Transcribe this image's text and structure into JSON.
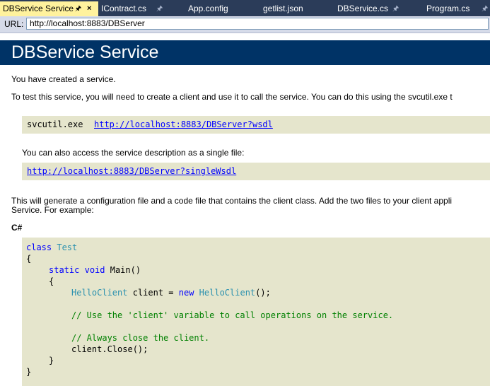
{
  "tabs": [
    {
      "label": "DBService Service",
      "active": true
    },
    {
      "label": "IContract.cs"
    },
    {
      "label": "App.config"
    },
    {
      "label": "getlist.json"
    },
    {
      "label": "DBService.cs"
    },
    {
      "label": "Program.cs"
    }
  ],
  "url_bar": {
    "label": "URL:",
    "value": "http://localhost:8883/DBServer"
  },
  "page": {
    "title": "DBService Service",
    "created_text": "You have created a service.",
    "test_text": "To test this service, you will need to create a client and use it to call the service. You can do this using the svcutil.exe t",
    "svcutil_cmd": "svcutil.exe",
    "wsdl_link": "http://localhost:8883/DBServer?wsdl",
    "single_file_text": "You can also access the service description as a single file:",
    "single_wsdl_link": "http://localhost:8883/DBServer?singleWsdl",
    "generate_text_1": "This will generate a configuration file and a code file that contains the client class. Add the two files to your client appli",
    "generate_text_2": "Service. For example:",
    "csharp_label": "C#",
    "code": {
      "class_kw": "class",
      "class_name": "Test",
      "open_brace": "{",
      "static_kw": "static",
      "void_kw": "void",
      "main_sig": "Main()",
      "inner_open": "{",
      "client_type": "HelloClient",
      "client_decl": "client =",
      "new_kw": "new",
      "client_type2": "HelloClient",
      "ctor_end": "();",
      "comment1": "// Use the 'client' variable to call operations on the service.",
      "comment2": "// Always close the client.",
      "close_call": "client.Close();",
      "inner_close": "}",
      "close_brace": "}"
    }
  },
  "colors": {
    "tab_bar": "#2b3c59",
    "active_tab": "#fff29d",
    "header": "#003366",
    "code_bg": "#e5e5cc"
  }
}
